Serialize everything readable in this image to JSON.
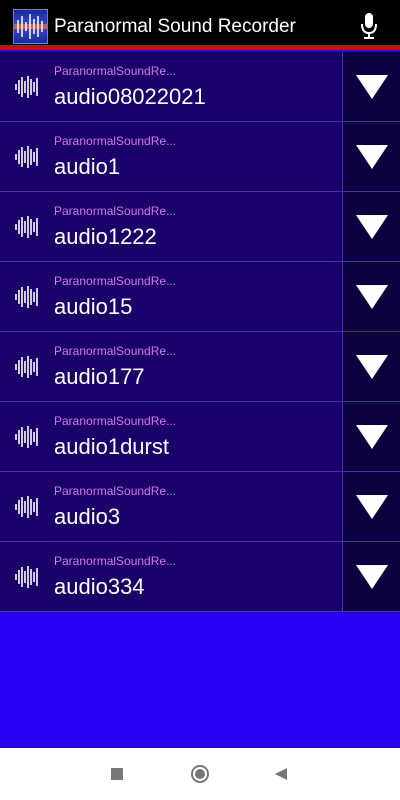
{
  "app_bar": {
    "title": "Paranormal Sound Recorder",
    "icons": {
      "app": "app-logo-icon",
      "mic": "microphone-icon"
    }
  },
  "recordings": [
    {
      "folder": "ParanormalSoundRe...",
      "name": "audio08022021"
    },
    {
      "folder": "ParanormalSoundRe...",
      "name": "audio1"
    },
    {
      "folder": "ParanormalSoundRe...",
      "name": "audio1222"
    },
    {
      "folder": "ParanormalSoundRe...",
      "name": "audio15"
    },
    {
      "folder": "ParanormalSoundRe...",
      "name": "audio177"
    },
    {
      "folder": "ParanormalSoundRe...",
      "name": "audio1durst"
    },
    {
      "folder": "ParanormalSoundRe...",
      "name": "audio3"
    },
    {
      "folder": "ParanormalSoundRe...",
      "name": "audio334"
    }
  ],
  "navigation": {
    "icons": [
      "square-recents-icon",
      "circle-home-icon",
      "triangle-back-icon"
    ]
  },
  "colors": {
    "background": "#2a00f2",
    "row": "#1a0068",
    "accent_red": "#e00000",
    "folder_text": "#d47ae8"
  }
}
